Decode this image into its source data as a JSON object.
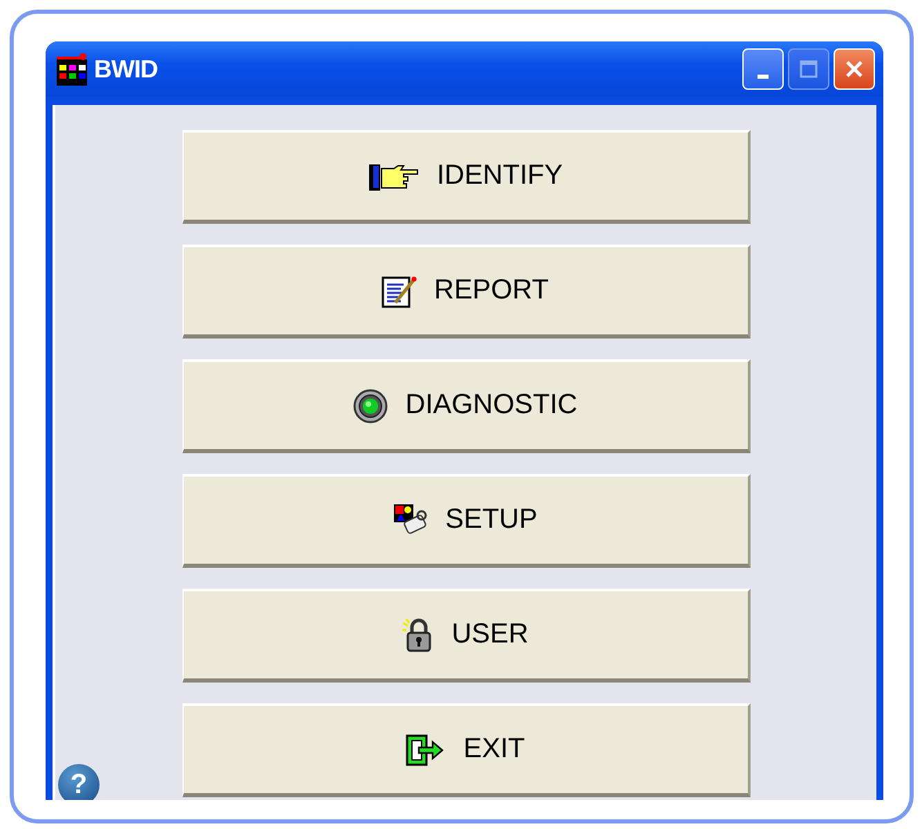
{
  "window": {
    "title": "BWID"
  },
  "title_buttons": [
    {
      "kind": "minimize",
      "disabled": false
    },
    {
      "kind": "maximize",
      "disabled": true
    },
    {
      "kind": "close",
      "disabled": false
    }
  ],
  "buttons": [
    {
      "label": "IDENTIFY",
      "kind": "hand"
    },
    {
      "label": "REPORT",
      "kind": "report"
    },
    {
      "label": "DIAGNOSTIC",
      "kind": "diagnostic"
    },
    {
      "label": "SETUP",
      "kind": "setup"
    },
    {
      "label": "USER",
      "kind": "lock"
    },
    {
      "label": "EXIT",
      "kind": "exit"
    }
  ],
  "help": {
    "label": "?"
  }
}
